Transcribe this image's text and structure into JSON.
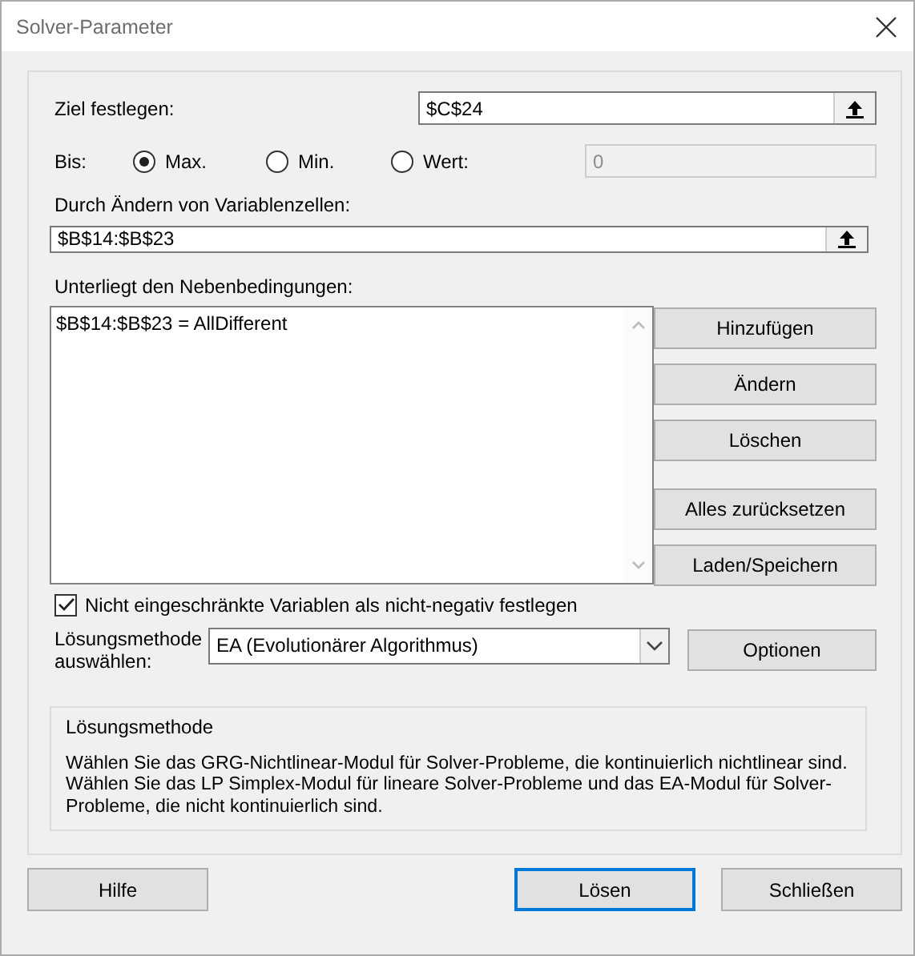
{
  "window": {
    "title": "Solver-Parameter"
  },
  "objective": {
    "label": "Ziel festlegen:",
    "value": "$C$24"
  },
  "to": {
    "label": "Bis:",
    "options": [
      {
        "label": "Max.",
        "selected": true
      },
      {
        "label": "Min.",
        "selected": false
      },
      {
        "label": "Wert:",
        "selected": false
      }
    ],
    "value_field": {
      "value": "0",
      "disabled": true
    }
  },
  "variables": {
    "label": "Durch Ändern von Variablenzellen:",
    "value": "$B$14:$B$23"
  },
  "constraints": {
    "label": "Unterliegt den Nebenbedingungen:",
    "items": [
      "$B$14:$B$23 = AllDifferent"
    ]
  },
  "constraint_buttons": [
    "Hinzufügen",
    "Ändern",
    "Löschen",
    "Alles zurücksetzen",
    "Laden/Speichern"
  ],
  "nonnegative": {
    "label": "Nicht eingeschränkte Variablen als nicht-negativ festlegen",
    "checked": true
  },
  "method": {
    "label": "Lösungsmethode auswählen:",
    "value": "EA (Evolutionärer Algorithmus)"
  },
  "options_button": "Optionen",
  "info": {
    "title": "Lösungsmethode",
    "text": "Wählen Sie das GRG-Nichtlinear-Modul für Solver-Probleme, die kontinuierlich nichtlinear sind. Wählen Sie das LP Simplex-Modul für lineare Solver-Probleme und das EA-Modul für Solver-Probleme, die nicht kontinuierlich sind."
  },
  "footer_buttons": [
    {
      "label": "Hilfe",
      "default": false
    },
    {
      "label": "Lösen",
      "default": true
    },
    {
      "label": "Schließen",
      "default": false
    }
  ]
}
